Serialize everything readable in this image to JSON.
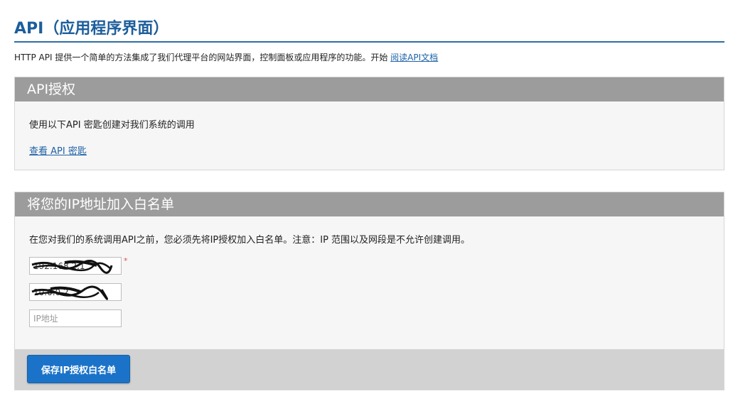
{
  "page": {
    "title": "API（应用程序界面）",
    "intro_text": "HTTP API 提供一个简单的方法集成了我们代理平台的网站界面，控制面板或应用程序的功能。开始",
    "intro_link": "阅读API文档"
  },
  "api_auth": {
    "header": "API授权",
    "description": "使用以下API 密匙创建对我们系统的调用",
    "link": "查看 API 密匙"
  },
  "whitelist": {
    "header": "将您的IP地址加入白名单",
    "description": "在您对我们的系统调用API之前，您必须先将IP授权加入白名单。注意：IP 范围以及网段是不允许创建调用。",
    "inputs": [
      {
        "value": "192.168.2.1",
        "placeholder": "",
        "redacted": true
      },
      {
        "value": "10.0.0.2",
        "placeholder": "",
        "redacted": true
      },
      {
        "value": "",
        "placeholder": "IP地址",
        "redacted": false
      }
    ],
    "required_mark": "*",
    "save_label": "保存IP授权白名单"
  },
  "colors": {
    "title": "#1c5e9c",
    "panel_header": "#9c9c9c",
    "button": "#1a73c9",
    "link": "#1f62a7"
  }
}
